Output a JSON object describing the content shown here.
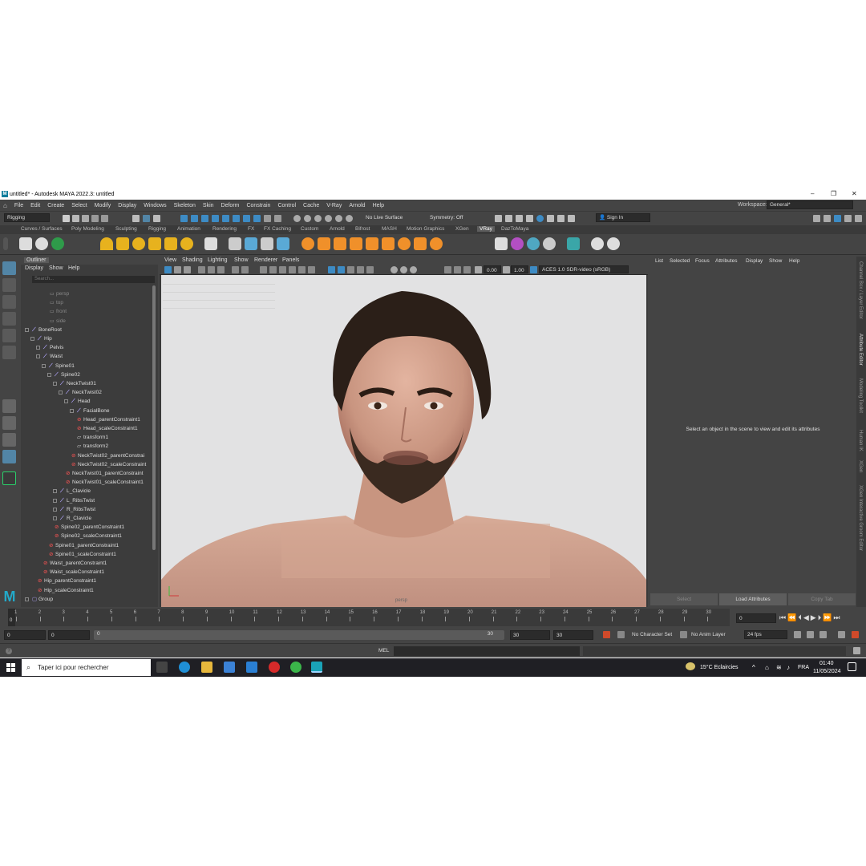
{
  "window": {
    "title": "untitled* - Autodesk MAYA 2022.3: untitled",
    "logo_letter": "M",
    "controls": [
      "–",
      "❐",
      "✕"
    ]
  },
  "menubar": {
    "items": [
      "File",
      "Edit",
      "Create",
      "Select",
      "Modify",
      "Display",
      "Windows",
      "Skeleton",
      "Skin",
      "Deform",
      "Constrain",
      "Control",
      "Cache",
      "V-Ray",
      "Arnold",
      "Help"
    ],
    "workspace_label": "Workspace:",
    "workspace_value": "General*"
  },
  "statusline": {
    "menuset": "Rigging",
    "live_surface": "No Live Surface",
    "symmetry": "Symmetry: Off",
    "signin": "Sign In"
  },
  "shelf": {
    "tabs": [
      "Curves / Surfaces",
      "Poly Modeling",
      "Sculpting",
      "Rigging",
      "Animation",
      "Rendering",
      "FX",
      "FX Caching",
      "Custom",
      "Arnold",
      "Bifrost",
      "MASH",
      "Motion Graphics",
      "XGen",
      "VRay",
      "DazToMaya"
    ],
    "active_tab": "VRay"
  },
  "outliner": {
    "title": "Outliner",
    "menu": [
      "Display",
      "Show",
      "Help"
    ],
    "search_placeholder": "Search...",
    "nodes": [
      {
        "label": "persp",
        "type": "camera"
      },
      {
        "label": "top",
        "type": "camera"
      },
      {
        "label": "front",
        "type": "camera"
      },
      {
        "label": "side",
        "type": "camera"
      },
      {
        "label": "BoneRoot",
        "type": "joint"
      },
      {
        "label": "Hip",
        "type": "joint"
      },
      {
        "label": "Pelvis",
        "type": "joint"
      },
      {
        "label": "Waist",
        "type": "joint"
      },
      {
        "label": "Spine01",
        "type": "joint"
      },
      {
        "label": "Spine02",
        "type": "joint"
      },
      {
        "label": "NeckTwist01",
        "type": "joint"
      },
      {
        "label": "NeckTwist02",
        "type": "joint"
      },
      {
        "label": "Head",
        "type": "joint"
      },
      {
        "label": "FacialBone",
        "type": "joint"
      },
      {
        "label": "Head_parentConstraint1",
        "type": "constraint"
      },
      {
        "label": "Head_scaleConstraint1",
        "type": "constraint"
      },
      {
        "label": "transform1",
        "type": "transform"
      },
      {
        "label": "transform2",
        "type": "transform"
      },
      {
        "label": "NeckTwist02_parentConstrai",
        "type": "constraint"
      },
      {
        "label": "NeckTwist02_scaleConstraint",
        "type": "constraint"
      },
      {
        "label": "NeckTwist01_parentConstraint",
        "type": "constraint"
      },
      {
        "label": "NeckTwist01_scaleConstraint1",
        "type": "constraint"
      },
      {
        "label": "L_Clavicle",
        "type": "joint"
      },
      {
        "label": "L_RibsTwist",
        "type": "joint"
      },
      {
        "label": "R_RibsTwist",
        "type": "joint"
      },
      {
        "label": "R_Clavicle",
        "type": "joint"
      },
      {
        "label": "Spine02_parentConstraint1",
        "type": "constraint"
      },
      {
        "label": "Spine02_scaleConstraint1",
        "type": "constraint"
      },
      {
        "label": "Spine01_parentConstraint1",
        "type": "constraint"
      },
      {
        "label": "Spine01_scaleConstraint1",
        "type": "constraint"
      },
      {
        "label": "Waist_parentConstraint1",
        "type": "constraint"
      },
      {
        "label": "Waist_scaleConstraint1",
        "type": "constraint"
      },
      {
        "label": "Hip_parentConstraint1",
        "type": "constraint"
      },
      {
        "label": "Hip_scaleConstraint1",
        "type": "constraint"
      },
      {
        "label": "Group",
        "type": "group"
      }
    ]
  },
  "viewport": {
    "menus": [
      "View",
      "Shading",
      "Lighting",
      "Show",
      "Renderer",
      "Panels"
    ],
    "exposure": "0.00",
    "gamma": "1.00",
    "color_space": "ACES 1.0 SDR-video (sRGB)",
    "camera_label": "persp"
  },
  "attribute_editor": {
    "menu": [
      "List",
      "Selected",
      "Focus",
      "Attributes",
      "Display",
      "Show",
      "Help"
    ],
    "message": "Select an object in the scene to view and edit its attributes",
    "buttons": [
      "Select",
      "Load Attributes",
      "Copy Tab"
    ]
  },
  "side_tabs": [
    "Channel Box / Layer Editor",
    "Attribute Editor",
    "Modeling Toolkit",
    "Human IK",
    "XGen",
    "XGen Interactive Groom Editor"
  ],
  "timeline": {
    "ticks": [
      "1",
      "2",
      "3",
      "4",
      "5",
      "6",
      "7",
      "8",
      "9",
      "10",
      "11",
      "12",
      "13",
      "14",
      "15",
      "16",
      "17",
      "18",
      "19",
      "20",
      "21",
      "22",
      "23",
      "24",
      "25",
      "26",
      "27",
      "28",
      "29",
      "30"
    ],
    "current_frame_marker": "0",
    "current_frame_field": "0"
  },
  "range": {
    "start": "0",
    "playback_start": "0",
    "slider_start": "0",
    "slider_end": "30",
    "playback_end": "30",
    "end": "30",
    "character_set": "No Character Set",
    "anim_layer": "No Anim Layer",
    "fps": "24 fps"
  },
  "cmdline": {
    "language": "MEL"
  },
  "taskbar": {
    "search_placeholder": "Taper ici pour rechercher",
    "weather": "15°C  Eclaircies",
    "language": "FRA",
    "time": "01:40",
    "date": "11/05/2024"
  }
}
